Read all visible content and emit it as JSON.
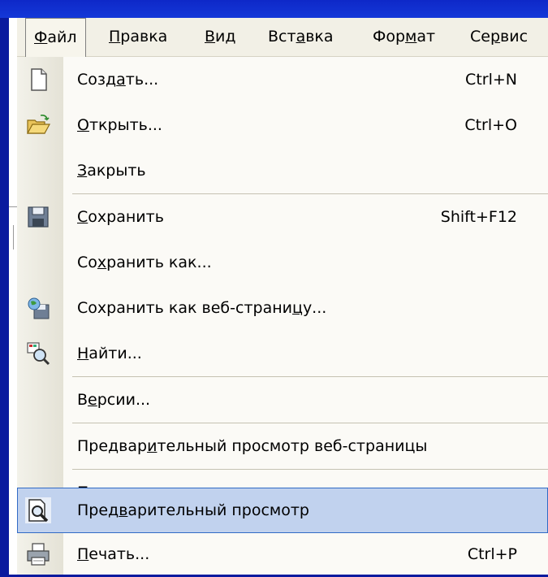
{
  "menubar": {
    "items": [
      {
        "label": "Файл",
        "prefix": "",
        "key": "Ф",
        "suffix": "айл",
        "active": true
      },
      {
        "label": "Правка",
        "prefix": "",
        "key": "П",
        "suffix": "равка"
      },
      {
        "label": "Вид",
        "prefix": "",
        "key": "В",
        "suffix": "ид"
      },
      {
        "label": "Вставка",
        "prefix": "Вст",
        "key": "а",
        "suffix": "вка"
      },
      {
        "label": "Формат",
        "prefix": "Фор",
        "key": "м",
        "suffix": "ат"
      },
      {
        "label": "Сервис",
        "prefix": "Се",
        "key": "р",
        "suffix": "вис"
      }
    ]
  },
  "menu": {
    "items": [
      {
        "label": "Создать...",
        "prefix": "Созд",
        "key": "а",
        "suffix": "ть...",
        "shortcut": "Ctrl+N",
        "icon": "new-document-icon"
      },
      {
        "label": "Открыть...",
        "prefix": "",
        "key": "О",
        "suffix": "ткрыть...",
        "shortcut": "Ctrl+O",
        "icon": "open-folder-icon"
      },
      {
        "label": "Закрыть",
        "prefix": "",
        "key": "З",
        "suffix": "акрыть",
        "shortcut": "",
        "icon": ""
      },
      {
        "label": "Сохранить",
        "prefix": "",
        "key": "С",
        "suffix": "охранить",
        "shortcut": "Shift+F12",
        "icon": "save-disk-icon"
      },
      {
        "label": "Сохранить как...",
        "prefix": "Со",
        "key": "х",
        "suffix": "ранить как...",
        "shortcut": "",
        "icon": ""
      },
      {
        "label": "Сохранить как веб-страницу...",
        "prefix": "Сохранить как веб-страни",
        "key": "ц",
        "suffix": "у...",
        "shortcut": "",
        "icon": "save-as-web-page-icon"
      },
      {
        "label": "Найти...",
        "prefix": "",
        "key": "Н",
        "suffix": "айти...",
        "shortcut": "",
        "icon": "find-icon"
      },
      {
        "label": "Версии...",
        "prefix": "В",
        "key": "е",
        "suffix": "рсии...",
        "shortcut": "",
        "icon": ""
      },
      {
        "label": "Предварительный просмотр веб-страницы",
        "prefix": "Предвар",
        "key": "и",
        "suffix": "тельный просмотр веб-страницы",
        "shortcut": "",
        "icon": ""
      },
      {
        "label": "Параметры страницы...",
        "prefix": "Пара",
        "key": "м",
        "suffix": "етры страницы...",
        "shortcut": "",
        "icon": ""
      },
      {
        "label": "Предварительный просмотр",
        "prefix": "Пред",
        "key": "в",
        "suffix": "арительный просмотр",
        "shortcut": "",
        "icon": "print-preview-icon",
        "highlighted": true
      },
      {
        "label": "Печать...",
        "prefix": "",
        "key": "П",
        "suffix": "ечать...",
        "shortcut": "Ctrl+P",
        "icon": "printer-icon"
      }
    ]
  },
  "colors": {
    "desktop": "#0a1a9e",
    "menu_background": "#fbfaf6",
    "highlight": "#c1d2ee",
    "highlight_border": "#316ac5"
  }
}
